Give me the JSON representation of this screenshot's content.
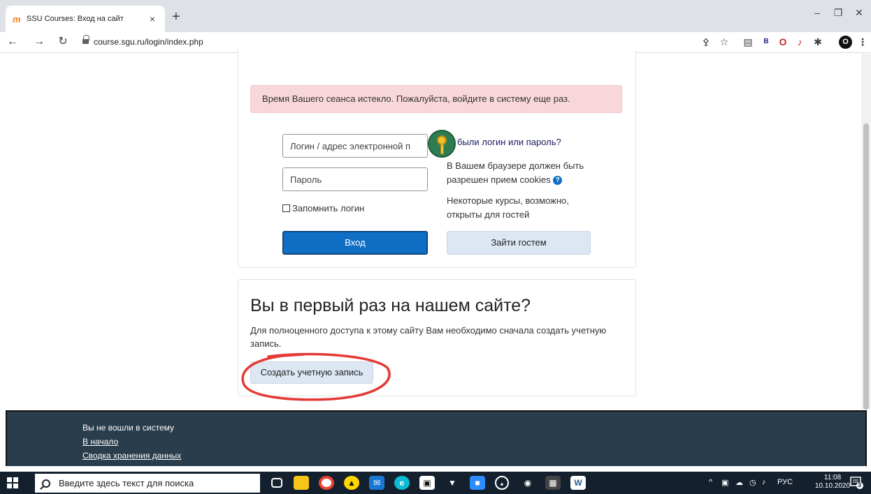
{
  "browser": {
    "tab_favicon": "m",
    "tab_title": "SSU Courses: Вход на сайт",
    "tab_close": "×",
    "new_tab": "+",
    "url": "course.sgu.ru/login/index.php",
    "profile_letter": "O",
    "extension_icons": [
      "key-icon",
      "star-icon",
      "translate-icon",
      "b-icon",
      "opera-icon",
      "music-icon",
      "puzzle-icon",
      "profile-icon",
      "menu-icon"
    ],
    "b_badge": "B",
    "menu": "⋮"
  },
  "login": {
    "alert": "Время Вашего сеанса истекло. Пожалуйста, войдите в систему еще раз.",
    "username_placeholder": "Логин / адрес электронной п",
    "password_placeholder": "Пароль",
    "remember_label": "Запомнить логин",
    "login_button": "Вход",
    "forgot_link": "были логин или пароль?",
    "cookies_line1": "В Вашем браузере должен быть",
    "cookies_line2": "разрешен прием cookies",
    "guest_line1": "Некоторые курсы, возможно,",
    "guest_line2": "открыты для гостей",
    "guest_button": "Зайти гостем",
    "help_symbol": "?"
  },
  "signup": {
    "heading": "Вы в первый раз на нашем сайте?",
    "text": "Для полноценного доступа к этому сайту Вам необходимо сначала создать учетную запись.",
    "create_button": "Создать учетную запись"
  },
  "footer": {
    "not_logged_in": "Вы не вошли в систему",
    "home_link": "В начало",
    "data_summary_link": "Сводка хранения данных"
  },
  "taskbar": {
    "search_placeholder": "Введите здесь текст для поиска",
    "tray_lang": "РУС",
    "time": "11:08",
    "date": "10.10.2020",
    "notification_count": "3",
    "word_badge": "W"
  },
  "colors": {
    "primary": "#0f6fc5",
    "alert_bg": "#f8d7da",
    "footer_bg": "#2a3d4c",
    "annotation": "#e53935"
  }
}
